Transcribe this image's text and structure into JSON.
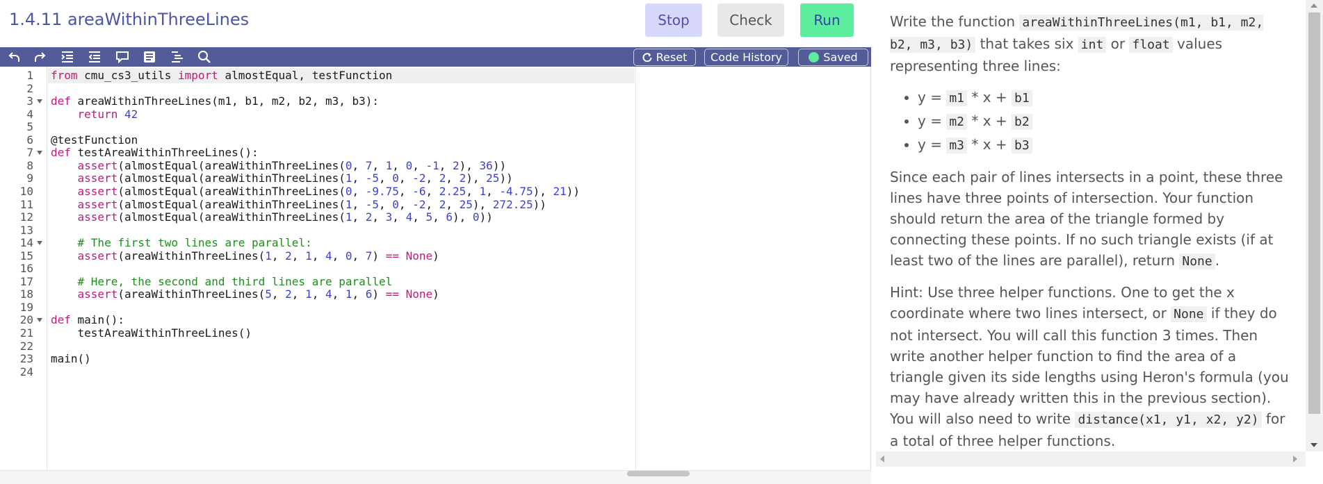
{
  "header": {
    "title": "1.4.11 areaWithinThreeLines",
    "stop_label": "Stop",
    "check_label": "Check",
    "run_label": "Run"
  },
  "toolbar": {
    "icons": [
      "undo-icon",
      "redo-icon",
      "indent-icon",
      "outdent-icon",
      "comment-icon",
      "format-icon",
      "list-icon",
      "search-icon"
    ],
    "reset_label": "Reset",
    "history_label": "Code History",
    "saved_label": "Saved"
  },
  "editor": {
    "lines": [
      {
        "n": "1",
        "fold": false
      },
      {
        "n": "2",
        "fold": false
      },
      {
        "n": "3",
        "fold": true
      },
      {
        "n": "4",
        "fold": false
      },
      {
        "n": "5",
        "fold": false
      },
      {
        "n": "6",
        "fold": false
      },
      {
        "n": "7",
        "fold": true
      },
      {
        "n": "8",
        "fold": false
      },
      {
        "n": "9",
        "fold": false
      },
      {
        "n": "10",
        "fold": false
      },
      {
        "n": "11",
        "fold": false
      },
      {
        "n": "12",
        "fold": false
      },
      {
        "n": "13",
        "fold": false
      },
      {
        "n": "14",
        "fold": true
      },
      {
        "n": "15",
        "fold": false
      },
      {
        "n": "16",
        "fold": false
      },
      {
        "n": "17",
        "fold": false
      },
      {
        "n": "18",
        "fold": false
      },
      {
        "n": "19",
        "fold": false
      },
      {
        "n": "20",
        "fold": true
      },
      {
        "n": "21",
        "fold": false
      },
      {
        "n": "22",
        "fold": false
      },
      {
        "n": "23",
        "fold": false
      },
      {
        "n": "24",
        "fold": false
      }
    ],
    "code": [
      [
        [
          "kw",
          "from"
        ],
        [
          "",
          " cmu_cs3_utils "
        ],
        [
          "kw",
          "import"
        ],
        [
          "",
          " almostEqual, testFunction"
        ]
      ],
      [],
      [
        [
          "kw",
          "def"
        ],
        [
          "",
          " areaWithinThreeLines(m1, b1, m2, b2, m3, b3):"
        ]
      ],
      [
        [
          "",
          "    "
        ],
        [
          "kw",
          "return"
        ],
        [
          "",
          " "
        ],
        [
          "num",
          "42"
        ]
      ],
      [],
      [
        [
          "dec",
          "@testFunction"
        ]
      ],
      [
        [
          "kw",
          "def"
        ],
        [
          "",
          " testAreaWithinThreeLines():"
        ]
      ],
      [
        [
          "",
          "    "
        ],
        [
          "kw",
          "assert"
        ],
        [
          "",
          "(almostEqual(areaWithinThreeLines("
        ],
        [
          "num",
          "0"
        ],
        [
          "",
          ", "
        ],
        [
          "num",
          "7"
        ],
        [
          "",
          ", "
        ],
        [
          "num",
          "1"
        ],
        [
          "",
          ", "
        ],
        [
          "num",
          "0"
        ],
        [
          "",
          ", "
        ],
        [
          "num",
          "-1"
        ],
        [
          "",
          ", "
        ],
        [
          "num",
          "2"
        ],
        [
          "",
          "), "
        ],
        [
          "num",
          "36"
        ],
        [
          "",
          "))"
        ]
      ],
      [
        [
          "",
          "    "
        ],
        [
          "kw",
          "assert"
        ],
        [
          "",
          "(almostEqual(areaWithinThreeLines("
        ],
        [
          "num",
          "1"
        ],
        [
          "",
          ", "
        ],
        [
          "num",
          "-5"
        ],
        [
          "",
          ", "
        ],
        [
          "num",
          "0"
        ],
        [
          "",
          ", "
        ],
        [
          "num",
          "-2"
        ],
        [
          "",
          ", "
        ],
        [
          "num",
          "2"
        ],
        [
          "",
          ", "
        ],
        [
          "num",
          "2"
        ],
        [
          "",
          "), "
        ],
        [
          "num",
          "25"
        ],
        [
          "",
          "))"
        ]
      ],
      [
        [
          "",
          "    "
        ],
        [
          "kw",
          "assert"
        ],
        [
          "",
          "(almostEqual(areaWithinThreeLines("
        ],
        [
          "num",
          "0"
        ],
        [
          "",
          ", "
        ],
        [
          "num",
          "-9.75"
        ],
        [
          "",
          ", "
        ],
        [
          "num",
          "-6"
        ],
        [
          "",
          ", "
        ],
        [
          "num",
          "2.25"
        ],
        [
          "",
          ", "
        ],
        [
          "num",
          "1"
        ],
        [
          "",
          ", "
        ],
        [
          "num",
          "-4.75"
        ],
        [
          "",
          "), "
        ],
        [
          "num",
          "21"
        ],
        [
          "",
          "))"
        ]
      ],
      [
        [
          "",
          "    "
        ],
        [
          "kw",
          "assert"
        ],
        [
          "",
          "(almostEqual(areaWithinThreeLines("
        ],
        [
          "num",
          "1"
        ],
        [
          "",
          ", "
        ],
        [
          "num",
          "-5"
        ],
        [
          "",
          ", "
        ],
        [
          "num",
          "0"
        ],
        [
          "",
          ", "
        ],
        [
          "num",
          "-2"
        ],
        [
          "",
          ", "
        ],
        [
          "num",
          "2"
        ],
        [
          "",
          ", "
        ],
        [
          "num",
          "25"
        ],
        [
          "",
          "), "
        ],
        [
          "num",
          "272.25"
        ],
        [
          "",
          "))"
        ]
      ],
      [
        [
          "",
          "    "
        ],
        [
          "kw",
          "assert"
        ],
        [
          "",
          "(almostEqual(areaWithinThreeLines("
        ],
        [
          "num",
          "1"
        ],
        [
          "",
          ", "
        ],
        [
          "num",
          "2"
        ],
        [
          "",
          ", "
        ],
        [
          "num",
          "3"
        ],
        [
          "",
          ", "
        ],
        [
          "num",
          "4"
        ],
        [
          "",
          ", "
        ],
        [
          "num",
          "5"
        ],
        [
          "",
          ", "
        ],
        [
          "num",
          "6"
        ],
        [
          "",
          "), "
        ],
        [
          "num",
          "0"
        ],
        [
          "",
          "))"
        ]
      ],
      [],
      [
        [
          "",
          "    "
        ],
        [
          "cm",
          "# The first two lines are parallel:"
        ]
      ],
      [
        [
          "",
          "    "
        ],
        [
          "kw",
          "assert"
        ],
        [
          "",
          "(areaWithinThreeLines("
        ],
        [
          "num",
          "1"
        ],
        [
          "",
          ", "
        ],
        [
          "num",
          "2"
        ],
        [
          "",
          ", "
        ],
        [
          "num",
          "1"
        ],
        [
          "",
          ", "
        ],
        [
          "num",
          "4"
        ],
        [
          "",
          ", "
        ],
        [
          "num",
          "0"
        ],
        [
          "",
          ", "
        ],
        [
          "num",
          "7"
        ],
        [
          "",
          ") "
        ],
        [
          "kw",
          "=="
        ],
        [
          "",
          " "
        ],
        [
          "kw",
          "None"
        ],
        [
          "",
          ")"
        ]
      ],
      [],
      [
        [
          "",
          "    "
        ],
        [
          "cm",
          "# Here, the second and third lines are parallel"
        ]
      ],
      [
        [
          "",
          "    "
        ],
        [
          "kw",
          "assert"
        ],
        [
          "",
          "(areaWithinThreeLines("
        ],
        [
          "num",
          "5"
        ],
        [
          "",
          ", "
        ],
        [
          "num",
          "2"
        ],
        [
          "",
          ", "
        ],
        [
          "num",
          "1"
        ],
        [
          "",
          ", "
        ],
        [
          "num",
          "4"
        ],
        [
          "",
          ", "
        ],
        [
          "num",
          "1"
        ],
        [
          "",
          ", "
        ],
        [
          "num",
          "6"
        ],
        [
          "",
          ") "
        ],
        [
          "kw",
          "=="
        ],
        [
          "",
          " "
        ],
        [
          "kw",
          "None"
        ],
        [
          "",
          ")"
        ]
      ],
      [],
      [
        [
          "kw",
          "def"
        ],
        [
          "",
          " main():"
        ]
      ],
      [
        [
          "",
          "    testAreaWithinThreeLines()"
        ]
      ],
      [],
      [
        [
          "",
          "main()"
        ]
      ],
      []
    ]
  },
  "instructions": {
    "p1_a": "Write the function ",
    "p1_code1": "areaWithinThreeLines(m1, b1, m2, b2, m3, b3)",
    "p1_b": " that takes six ",
    "p1_code2": "int",
    "p1_c": " or ",
    "p1_code3": "float",
    "p1_d": " values representing three lines:",
    "bullets": [
      {
        "pre": "y = ",
        "m": "m1",
        "mid": " * x + ",
        "b": "b1"
      },
      {
        "pre": "y = ",
        "m": "m2",
        "mid": " * x + ",
        "b": "b2"
      },
      {
        "pre": "y = ",
        "m": "m3",
        "mid": " * x + ",
        "b": "b3"
      }
    ],
    "p2_a": "Since each pair of lines intersects in a point, these three lines have three points of intersection. Your function should return the area of the triangle formed by connecting these points. If no such triangle exists (if at least two of the lines are parallel), return ",
    "p2_code": "None",
    "p2_b": ".",
    "p3_a": "Hint: Use three helper functions. One to get the x coordinate where two lines intersect, or ",
    "p3_code1": "None",
    "p3_b": " if they do not intersect. You will call this function 3 times. Then write another helper function to find the area of a triangle given its side lengths using Heron's formula (you may have already written this in the previous section). You will also need to write ",
    "p3_code2": "distance(x1, y1, x2, y2)",
    "p3_c": " for a total of three helper functions."
  }
}
